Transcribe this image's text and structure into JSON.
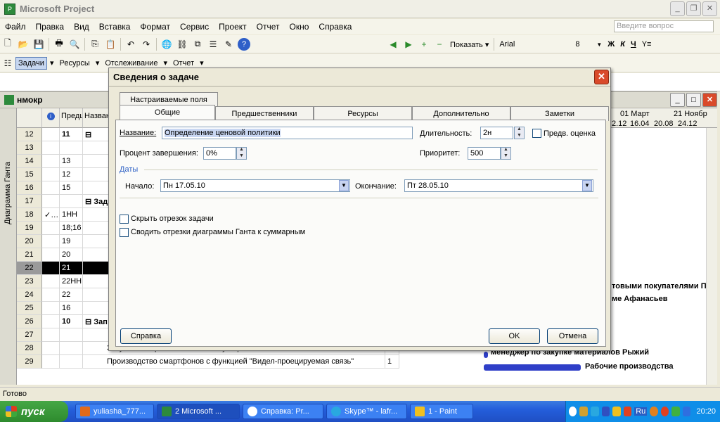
{
  "app": {
    "title": "Microsoft Project"
  },
  "menu": {
    "items": [
      "Файл",
      "Правка",
      "Вид",
      "Вставка",
      "Формат",
      "Сервис",
      "Проект",
      "Отчет",
      "Окно",
      "Справка"
    ],
    "ask_placeholder": "Введите вопрос"
  },
  "toolbar2": {
    "show_label": "Показать",
    "font": "Arial",
    "size": "8",
    "bold": "Ж",
    "italic": "К",
    "underline": "Ч"
  },
  "toolbar3": {
    "tasks": "Задачи",
    "resources": "Ресурсы",
    "tracking": "Отслеживание",
    "report": "Отчет"
  },
  "inner_window": {
    "title": "нмокр"
  },
  "sheet": {
    "headers": {
      "predecessors": "Предш",
      "name": "Назван",
      "vlabel": "Диаграмма Ганта"
    },
    "timescale": {
      "top": [
        "01 Март",
        "21 Ноябр"
      ],
      "bottom": [
        "2.12",
        "16.04",
        "20.08",
        "24.12"
      ]
    },
    "rows": [
      {
        "n": "12",
        "pred": "11",
        "name": "⊟",
        "bold": true
      },
      {
        "n": "13",
        "pred": "",
        "name": ""
      },
      {
        "n": "14",
        "pred": "13",
        "name": ""
      },
      {
        "n": "15",
        "pred": "12",
        "name": ""
      },
      {
        "n": "16",
        "pred": "15",
        "name": ""
      },
      {
        "n": "17",
        "pred": "",
        "name": "⊟ Зад",
        "bold": true
      },
      {
        "n": "18",
        "pred": "1НН",
        "name": "",
        "ind": "✓…"
      },
      {
        "n": "19",
        "pred": "18;16",
        "name": ""
      },
      {
        "n": "20",
        "pred": "19",
        "name": ""
      },
      {
        "n": "21",
        "pred": "20",
        "name": ""
      },
      {
        "n": "22",
        "pred": "21",
        "name": "",
        "selected": true
      },
      {
        "n": "23",
        "pred": "22НН",
        "name": ""
      },
      {
        "n": "24",
        "pred": "22",
        "name": ""
      },
      {
        "n": "25",
        "pred": "16",
        "name": ""
      },
      {
        "n": "26",
        "pred": "10",
        "name": "⊟ Зап",
        "bold": true
      },
      {
        "n": "27",
        "pred": "",
        "name": ""
      },
      {
        "n": "28",
        "pred": "",
        "name": "Закупка материалов и комплектующих",
        "dur": "2"
      },
      {
        "n": "29",
        "pred": "",
        "name": "Производство смартфонов с функцией \"Видел-проецируемая связь\"",
        "dur": "1"
      }
    ],
    "gantt_labels": [
      "товыми покупателями П",
      "ме Афанасьев",
      "менеджер по закупке материалов Рыжий",
      "Рабочие производства"
    ]
  },
  "status": {
    "text": "Готово"
  },
  "taskbar": {
    "start": "пуск",
    "tasks": [
      "yuliasha_777...",
      "2 Microsoft ...",
      "Справка: Pr...",
      "Skype™ - lafr...",
      "1 - Paint"
    ],
    "lang": "Ru",
    "time": "20:20"
  },
  "dialog": {
    "title": "Сведения о задаче",
    "tabs_row1": [
      "Настраиваемые поля"
    ],
    "tabs_row2": [
      "Общие",
      "Предшественники",
      "Ресурсы",
      "Дополнительно",
      "Заметки"
    ],
    "name_label": "Название:",
    "name_value": "Определение ценовой политики",
    "duration_label": "Длительность:",
    "duration_value": "2н",
    "estimate_label": "Предв. оценка",
    "percent_label": "Процент завершения:",
    "percent_value": "0%",
    "priority_label": "Приоритет:",
    "priority_value": "500",
    "dates_label": "Даты",
    "start_label": "Начало:",
    "start_value": "Пн 17.05.10",
    "finish_label": "Окончание:",
    "finish_value": "Пт 28.05.10",
    "hide_bar_label": "Скрыть отрезок задачи",
    "rollup_label": "Сводить отрезки диаграммы Ганта к суммарным",
    "help_button": "Справка",
    "ok_button": "OK",
    "cancel_button": "Отмена"
  }
}
